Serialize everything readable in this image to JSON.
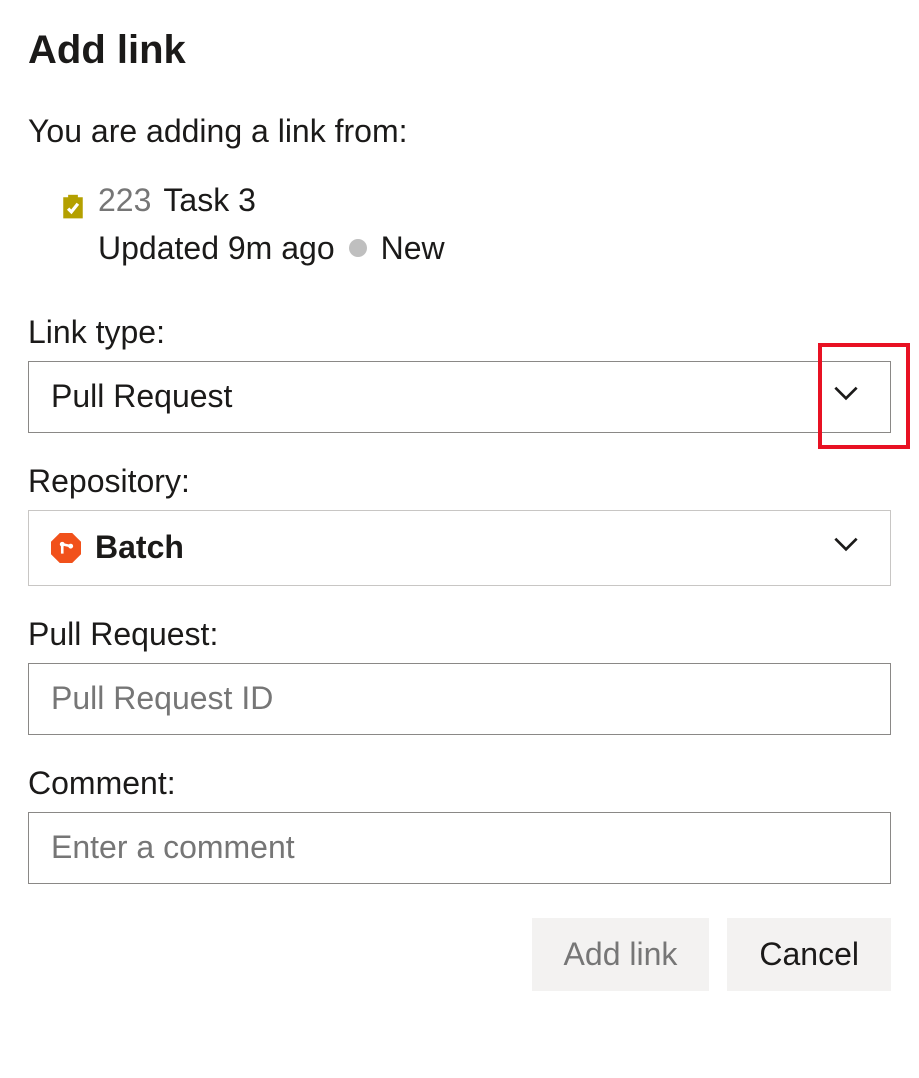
{
  "title": "Add link",
  "intro": "You are adding a link from:",
  "workItem": {
    "id": "223",
    "name": "Task 3",
    "updated": "Updated 9m ago",
    "state": "New"
  },
  "linkType": {
    "label": "Link type:",
    "value": "Pull Request"
  },
  "repository": {
    "label": "Repository:",
    "value": "Batch"
  },
  "pullRequest": {
    "label": "Pull Request:",
    "placeholder": "Pull Request ID"
  },
  "comment": {
    "label": "Comment:",
    "placeholder": "Enter a comment"
  },
  "buttons": {
    "addLink": "Add link",
    "cancel": "Cancel"
  }
}
